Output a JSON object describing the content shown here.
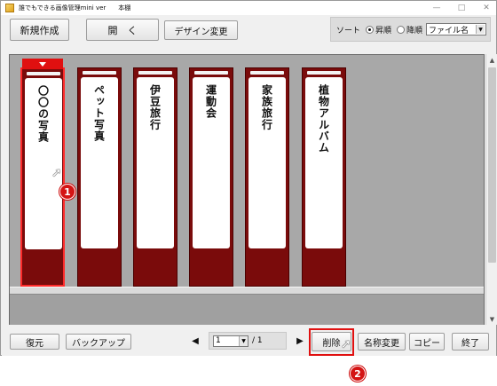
{
  "window": {
    "title": "誰でもできる画像管理mini ver　　本棚",
    "controls": [
      "—",
      "□",
      "✕"
    ]
  },
  "toolbar": {
    "new_label": "新規作成",
    "open_label": "開　く",
    "design_label": "デザイン変更",
    "sort_label": "ソート",
    "asc_label": "昇順",
    "desc_label": "降順",
    "sort_field": "ファイル名",
    "sort_order": "asc"
  },
  "binders": [
    {
      "label": "〇〇の写真",
      "selected": true
    },
    {
      "label": "ペット写真",
      "selected": false
    },
    {
      "label": "伊豆旅行",
      "selected": false
    },
    {
      "label": "運動会",
      "selected": false
    },
    {
      "label": "家族旅行",
      "selected": false
    },
    {
      "label": "植物アルバム",
      "selected": false
    }
  ],
  "callouts": {
    "one": "1",
    "two": "2"
  },
  "bottombar": {
    "restore_label": "復元",
    "backup_label": "バックアップ",
    "page_current": "1",
    "page_total": "/ 1",
    "delete_label": "削除",
    "rename_label": "名称変更",
    "copy_label": "コピー",
    "exit_label": "終了"
  },
  "colors": {
    "binder": "#7a0b0b",
    "selection": "#ff2a2a",
    "callout": "#d41414"
  }
}
